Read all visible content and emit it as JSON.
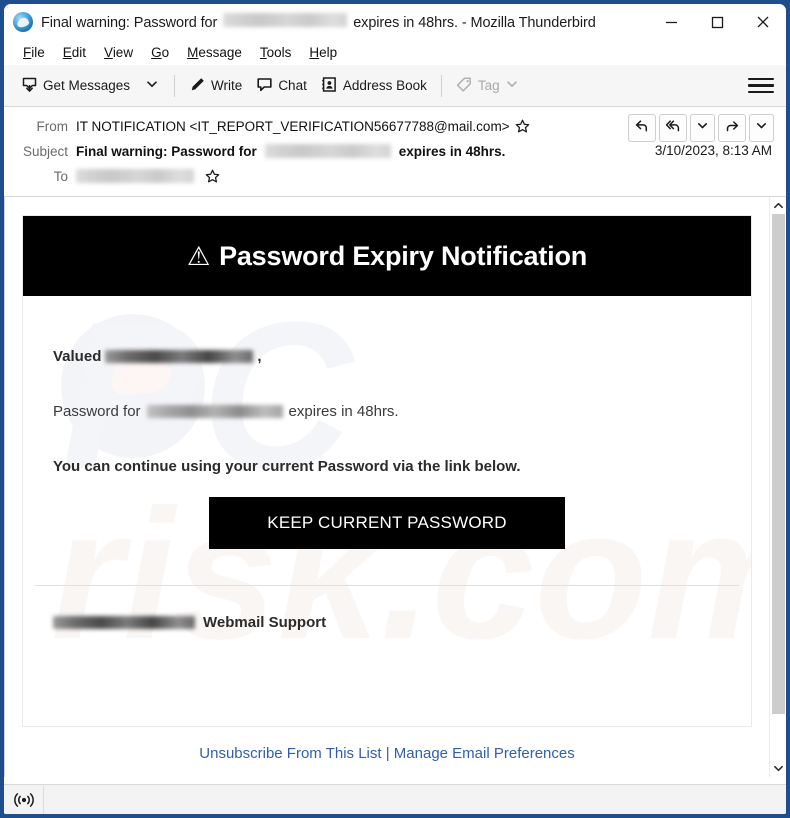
{
  "window": {
    "title_prefix": "Final warning: Password for",
    "title_suffix": "expires in 48hrs. - Mozilla Thunderbird",
    "app_icon": "thunderbird-icon",
    "minimize_label": "─",
    "maximize_label": "□",
    "close_label": "✕"
  },
  "menubar": {
    "items": [
      {
        "label": "File",
        "accesskey": "F"
      },
      {
        "label": "Edit",
        "accesskey": "E"
      },
      {
        "label": "View",
        "accesskey": "V"
      },
      {
        "label": "Go",
        "accesskey": "G"
      },
      {
        "label": "Message",
        "accesskey": "M"
      },
      {
        "label": "Tools",
        "accesskey": "T"
      },
      {
        "label": "Help",
        "accesskey": "H"
      }
    ]
  },
  "toolbar": {
    "get_messages_label": "Get Messages",
    "get_messages_icon": "download-inbox-icon",
    "get_messages_dropdown_icon": "chevron-down-icon",
    "write_label": "Write",
    "write_icon": "pencil-icon",
    "chat_label": "Chat",
    "chat_icon": "speech-bubble-icon",
    "address_book_label": "Address Book",
    "address_book_icon": "contact-card-icon",
    "tag_label": "Tag",
    "tag_icon": "tag-icon",
    "tag_dropdown_icon": "chevron-down-icon",
    "tag_disabled": true,
    "app_menu_icon": "hamburger-menu-icon"
  },
  "message_header": {
    "from_label": "From",
    "from_value": "IT NOTIFICATION <IT_REPORT_VERIFICATION56677788@mail.com>",
    "from_star_icon": "star-outline-icon",
    "subject_label": "Subject",
    "subject_prefix": "Final warning: Password for",
    "subject_suffix": "expires in 48hrs.",
    "to_label": "To",
    "to_star_icon": "star-outline-icon",
    "date": "3/10/2023, 8:13 AM",
    "actions": [
      {
        "name": "reply-button",
        "icon": "reply-arrow-icon"
      },
      {
        "name": "reply-all-button",
        "icon": "reply-all-arrow-icon"
      },
      {
        "name": "reply-more-button",
        "icon": "chevron-down-icon"
      },
      {
        "name": "forward-button",
        "icon": "forward-arrow-icon"
      },
      {
        "name": "more-actions-button",
        "icon": "chevron-down-icon"
      }
    ]
  },
  "email": {
    "banner_warning_icon": "⚠",
    "banner_title": "Password Expiry Notification",
    "greeting_prefix": "Valued",
    "greeting_suffix": ",",
    "line2_prefix": "Password for",
    "line2_suffix": "expires in 48hrs.",
    "line3": "You can continue using your current Password via the link below.",
    "cta_label": "KEEP CURRENT PASSWORD",
    "signature_suffix": "Webmail Support",
    "footer_link_1": "Unsubscribe From This List",
    "footer_sep": "|",
    "footer_link_2": "Manage Email Preferences",
    "watermark_text_1": "PC",
    "watermark_text_2": "risk.com",
    "redacted_note": "email address redacted"
  },
  "scrollbar": {
    "up_icon": "chevron-up-icon",
    "down_icon": "chevron-down-icon"
  },
  "statusbar": {
    "connection_icon": "broadcast-online-icon"
  },
  "colors": {
    "window_border": "#1f4e8c",
    "banner_bg": "#000000",
    "cta_bg": "#000000",
    "link": "#2f5fae",
    "toolbar_bg": "#f6f6f6"
  }
}
